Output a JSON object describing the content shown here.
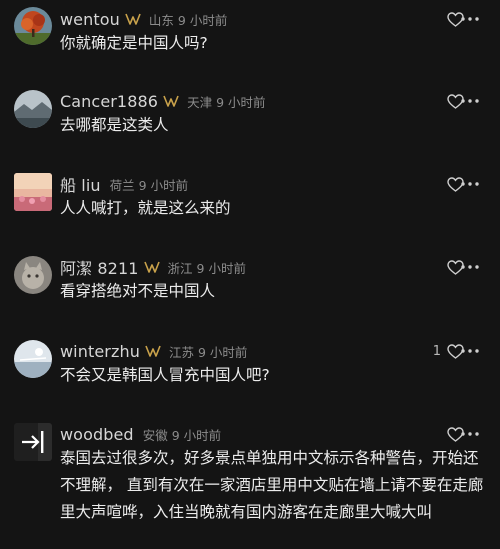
{
  "comments": [
    {
      "username": "wentou",
      "location": "山东",
      "time": "9 小时前",
      "text": "你就确定是中国人吗?",
      "likes": "",
      "has_badge": true,
      "avatar_icon": "autumn-tree-avatar"
    },
    {
      "username": "Cancer1886",
      "location": "天津",
      "time": "9 小时前",
      "text": "去哪都是这类人",
      "likes": "",
      "has_badge": true,
      "avatar_icon": "landscape-avatar"
    },
    {
      "username": "船 liu",
      "location": "荷兰",
      "time": "9 小时前",
      "text": "人人喊打，就是这么来的",
      "likes": "",
      "has_badge": false,
      "avatar_icon": "sunset-flowers-avatar"
    },
    {
      "username": "阿潔 8211",
      "location": "浙江",
      "time": "9 小时前",
      "text": "看穿搭绝对不是中国人",
      "likes": "",
      "has_badge": true,
      "avatar_icon": "cat-avatar"
    },
    {
      "username": "winterzhu",
      "location": "江苏",
      "time": "9 小时前",
      "text": "不会又是韩国人冒充中国人吧?",
      "likes": "1",
      "has_badge": true,
      "avatar_icon": "sky-avatar"
    },
    {
      "username": "woodbed",
      "location": "安徽",
      "time": "9 小时前",
      "text": "泰国去过很多次，好多景点单独用中文标示各种警告，开始还不理解，  直到有次在一家酒店里用中文贴在墙上请不要在走廊里大声喧哗，入住当晚就有国内游客在走廊里大喊大叫",
      "likes": "",
      "has_badge": false,
      "avatar_icon": "arrow-avatar"
    }
  ],
  "colors": {
    "background": "#141414",
    "username": "#d6d6d6",
    "meta": "#8c8c8c",
    "text": "#ececec",
    "badge": "#c9a24b",
    "icon": "#cfcfcf"
  }
}
